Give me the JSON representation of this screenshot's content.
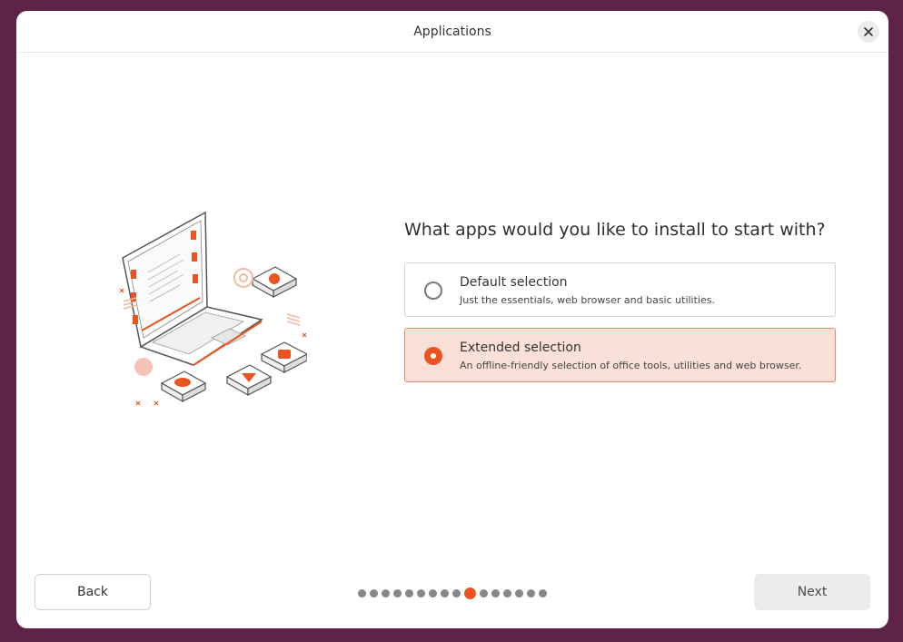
{
  "window": {
    "title": "Applications"
  },
  "question": "What apps would you like to install to start with?",
  "options": [
    {
      "title": "Default selection",
      "description": "Just the essentials, web browser and basic utilities.",
      "selected": false
    },
    {
      "title": "Extended selection",
      "description": "An offline-friendly selection of office tools, utilities and web browser.",
      "selected": true
    }
  ],
  "footer": {
    "back_label": "Back",
    "next_label": "Next",
    "progress": {
      "total_steps": 16,
      "current_step": 10
    }
  },
  "colors": {
    "accent": "#e95420",
    "selected_bg": "#fbe0d7",
    "desktop_bg": "#5e2346"
  },
  "icons": [
    "close-icon",
    "laptop-illustration"
  ]
}
